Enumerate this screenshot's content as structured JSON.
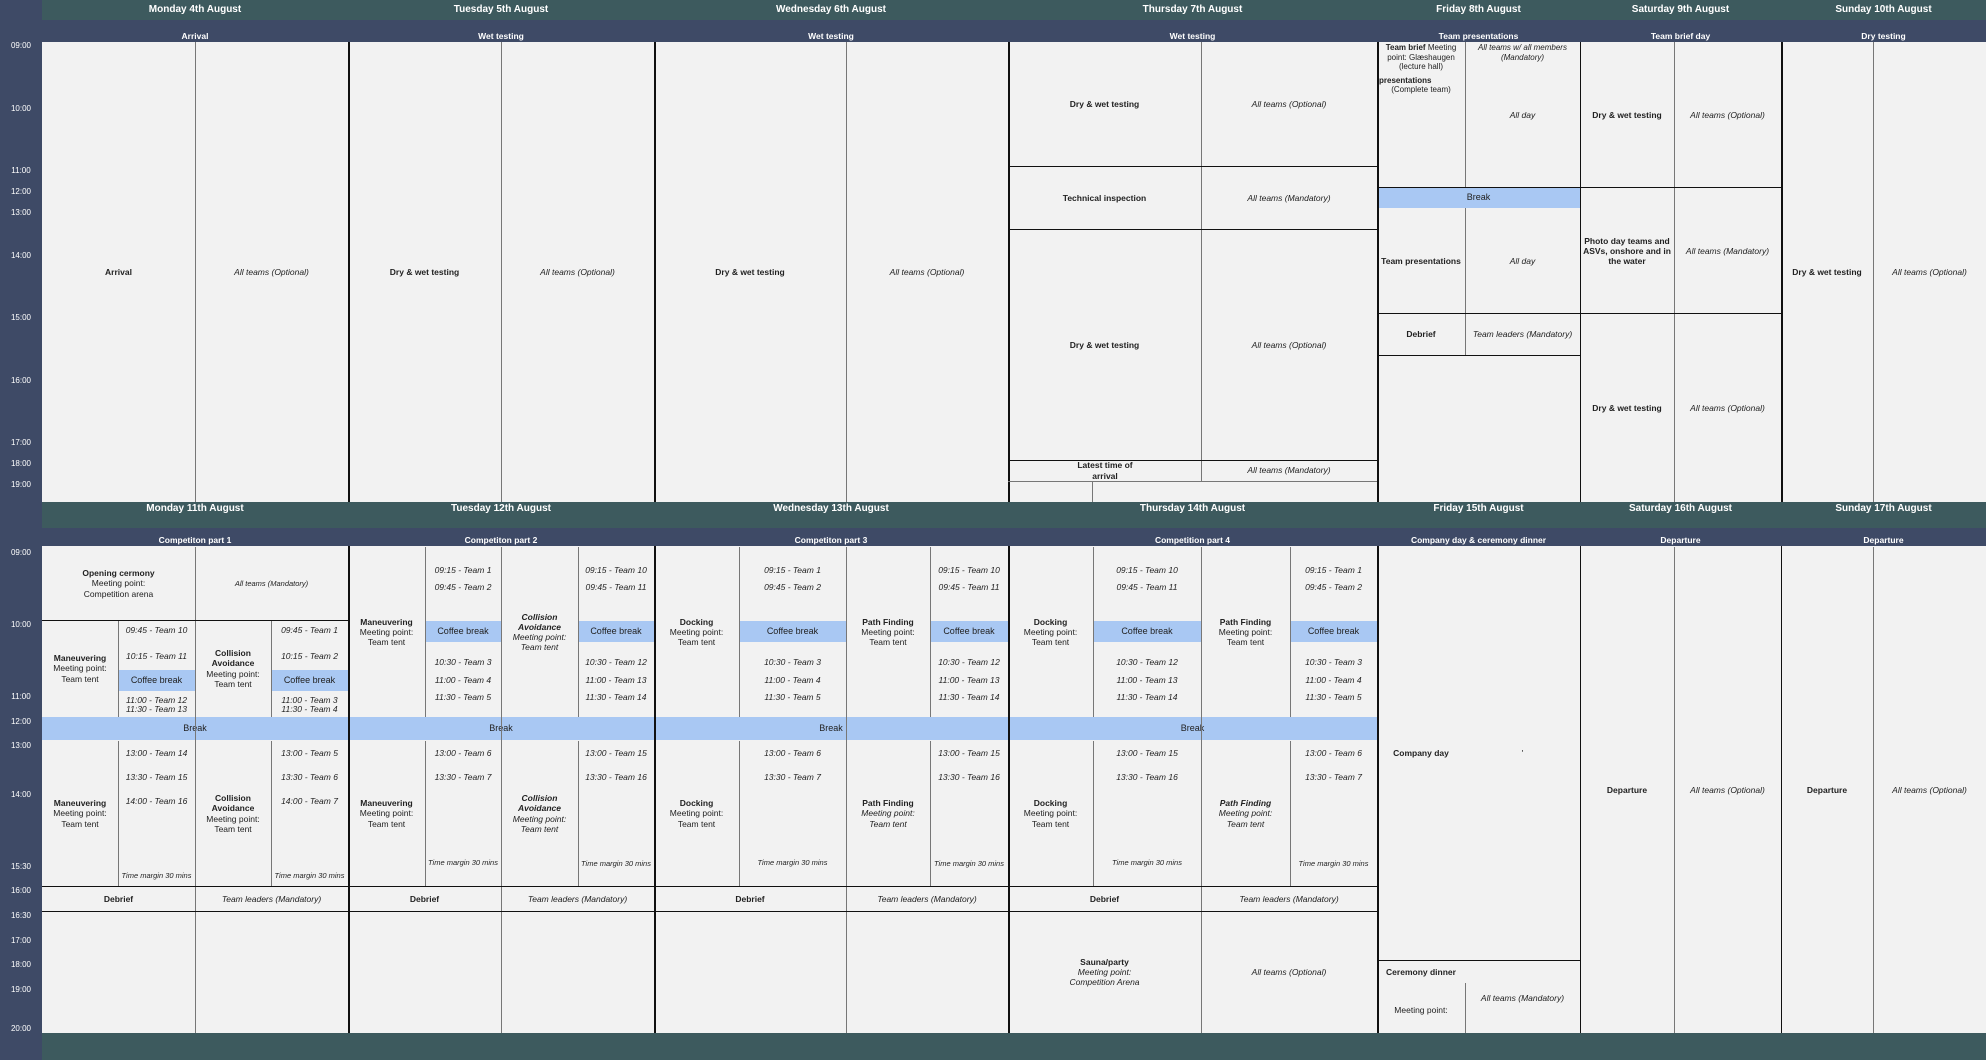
{
  "week1": {
    "days": [
      "Monday 4th August",
      "Tuesday 5th August",
      "Wednesday 6th August",
      "Thursday 7th August",
      "Friday 8th August",
      "Saturday 9th August",
      "Sunday 10th August"
    ],
    "themes": [
      "Arrival",
      "Wet testing",
      "Wet testing",
      "Wet testing",
      "Team presentations",
      "Team brief day",
      "Dry testing"
    ],
    "times": [
      "09:00",
      "10:00",
      "11:00",
      "12:00",
      "13:00",
      "14:00",
      "15:00",
      "16:00",
      "17:00",
      "18:00",
      "19:00"
    ],
    "mon": {
      "title": "Arrival",
      "who": "All teams (Optional)"
    },
    "tue": {
      "title": "Dry & wet testing",
      "who": "All teams (Optional)"
    },
    "wed": {
      "title": "Dry & wet testing",
      "who": "All teams (Optional)"
    },
    "thu": {
      "a_title": "Dry & wet testing",
      "a_who": "All teams (Optional)",
      "b_title": "Technical inspection",
      "b_who": "All teams (Mandatory)",
      "c_title": "Dry & wet testing",
      "c_who": "All teams (Optional)",
      "d_title": "Latest time of arrival",
      "d_who": "All teams (Mandatory)"
    },
    "fri": {
      "brief_title": "Team brief",
      "brief_meet": "Meeting point: Glæshaugen (lecture hall)",
      "brief_who": "All teams  w/ all members (Mandatory)",
      "pres1_title": "presentations",
      "pres1_note": "(Complete team)",
      "pres1_who": "All day",
      "break": "Break",
      "pres2_title": "Team presentations",
      "pres2_who": "All day",
      "debrief_title": "Debrief",
      "debrief_who": "Team leaders (Mandatory)"
    },
    "sat": {
      "a_title": "Dry & wet testing",
      "a_who": "All teams (Optional)",
      "b_title": "Photo day teams and ASVs, onshore and in the water",
      "b_who": "All teams (Mandatory)",
      "c_title": "Dry & wet testing",
      "c_who": "All teams (Optional)"
    },
    "sun": {
      "title": "Dry & wet testing",
      "who": "All teams (Optional)"
    }
  },
  "week2": {
    "days": [
      "Monday 11th August",
      "Tuesday 12th August",
      "Wednesday 13th August",
      "Thursday 14th August",
      "Friday 15th August",
      "Saturday 16th August",
      "Sunday 17th August"
    ],
    "themes": [
      "Competiton part 1",
      "Competiton part 2",
      "Competiton part 3",
      "Competition part 4",
      "Company day & ceremony dinner",
      "Departure",
      "Departure"
    ],
    "times": [
      "09:00",
      "10:00",
      "11:00",
      "12:00",
      "13:00",
      "14:00",
      "15:30",
      "16:00",
      "16:30",
      "17:00",
      "18:00",
      "19:00",
      "20:00"
    ],
    "coffee": "Coffee break",
    "break": "Break",
    "margin": "Time margin 30 mins",
    "debrief": "Debrief",
    "debrief_who": "Team leaders (Mandatory)",
    "meet_tent": "Meeting point: Team tent",
    "mon": {
      "open_title": "Opening cermony",
      "open_meet": "Meeting point: Competition arena",
      "open_who": "All teams (Mandatory)",
      "am1_title": "Maneuvering",
      "am1_slots": [
        "09:45 - Team 10",
        "10:15 - Team 11",
        "11:00 - Team 12",
        "11:30 - Team 13"
      ],
      "am2_title": "Collision Avoidance",
      "am2_slots": [
        "09:45 - Team 1",
        "10:15 - Team 2",
        "11:00 - Team 3",
        "11:30 - Team 4"
      ],
      "pm1_title": "Maneuvering",
      "pm1_slots": [
        "13:00 - Team 14",
        "13:30 - Team 15",
        "14:00 - Team 16"
      ],
      "pm2_title": "Collision Avoidance",
      "pm2_slots": [
        "13:00 - Team 5",
        "13:30 - Team 6",
        "14:00 - Team 7"
      ]
    },
    "tue": {
      "am1_title": "Maneuvering",
      "am1_slots": [
        "09:15 - Team 1",
        "09:45 - Team 2",
        "10:30 - Team 3",
        "11:00 - Team 4",
        "11:30 - Team 5"
      ],
      "am2_title": "Collision Avoidance",
      "am2_slots": [
        "09:15 - Team 10",
        "09:45 - Team 11",
        "10:30 - Team 12",
        "11:00 - Team 13",
        "11:30 - Team 14"
      ],
      "pm1_title": "Maneuvering",
      "pm1_slots": [
        "13:00 - Team 6",
        "13:30 - Team 7"
      ],
      "pm2_title": "Collision Avoidance",
      "pm2_slots": [
        "13:00 - Team 15",
        "13:30 - Team 16"
      ]
    },
    "wed": {
      "am1_title": "Docking",
      "am1_slots": [
        "09:15 - Team 1",
        "09:45 - Team 2",
        "10:30 - Team 3",
        "11:00 - Team 4",
        "11:30 - Team 5"
      ],
      "am2_title": "Path Finding",
      "am2_slots": [
        "09:15 - Team 10",
        "09:45 - Team 11",
        "10:30 - Team 12",
        "11:00 - Team 13",
        "11:30 - Team 14"
      ],
      "pm1_title": "Docking",
      "pm1_slots": [
        "13:00 - Team 6",
        "13:30 - Team 7"
      ],
      "pm2_title": "Path Finding",
      "pm2_slots": [
        "13:00 - Team 15",
        "13:30 - Team 16"
      ]
    },
    "thu": {
      "am1_title": "Docking",
      "am1_slots": [
        "09:15 - Team 10",
        "09:45 - Team 11",
        "10:30 - Team 12",
        "11:00 - Team 13",
        "11:30 - Team 14"
      ],
      "am2_title": "Path Finding",
      "am2_slots": [
        "09:15 - Team 1",
        "09:45 - Team 2",
        "10:30 - Team 3",
        "11:00 - Team 4",
        "11:30 - Team 5"
      ],
      "pm1_title": "Docking",
      "pm1_slots": [
        "13:00 - Team 15",
        "13:30 - Team 16"
      ],
      "pm2_title": "Path Finding",
      "pm2_slots": [
        "13:00 - Team 6",
        "13:30 - Team 7"
      ],
      "sauna_title": "Sauna/party",
      "sauna_meet": "Meeting point: Competition Arena",
      "sauna_who": "All teams (Optional)"
    },
    "fri": {
      "company_title": "Company day",
      "company_mark": "'",
      "dinner_title": "Ceremony dinner",
      "dinner_meet": "Meeting point:",
      "dinner_who": "All teams (Mandatory)"
    },
    "sat": {
      "title": "Departure",
      "who": "All teams (Optional)"
    },
    "sun": {
      "title": "Departure",
      "who": "All teams (Optional)"
    }
  }
}
